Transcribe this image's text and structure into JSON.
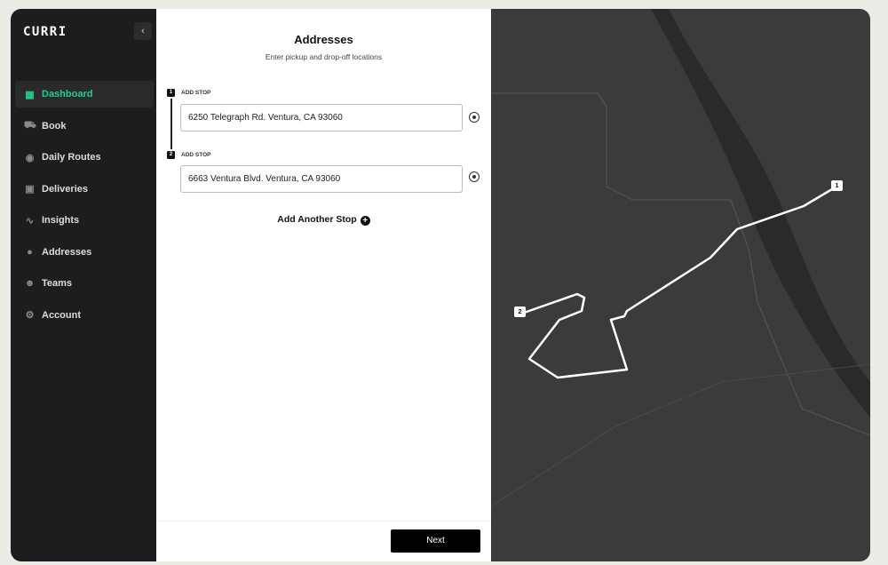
{
  "brand": "CURRI",
  "sidebar": {
    "collapse_icon": "chevron-left",
    "items": [
      {
        "label": "Dashboard",
        "icon": "grid",
        "active": true
      },
      {
        "label": "Book",
        "icon": "truck"
      },
      {
        "label": "Daily Routes",
        "icon": "map-pin"
      },
      {
        "label": "Deliveries",
        "icon": "box"
      },
      {
        "label": "Insights",
        "icon": "trend-line"
      },
      {
        "label": "Addresses",
        "icon": "globe"
      },
      {
        "label": "Teams",
        "icon": "users"
      },
      {
        "label": "Account",
        "icon": "gear"
      }
    ]
  },
  "form": {
    "title": "Addresses",
    "subtitle": "Enter pickup and drop-off locations",
    "stops": [
      {
        "number": "1",
        "label": "ADD STOP",
        "value": "6250 Telegraph Rd. Ventura, CA 93060"
      },
      {
        "number": "2",
        "label": "ADD STOP",
        "value": "6663 Ventura Blvd. Ventura, CA 93060"
      }
    ],
    "add_stop": "Add Another Stop",
    "next": "Next"
  },
  "map": {
    "markers": [
      "1",
      "2"
    ],
    "accent": "#1fd18b"
  }
}
